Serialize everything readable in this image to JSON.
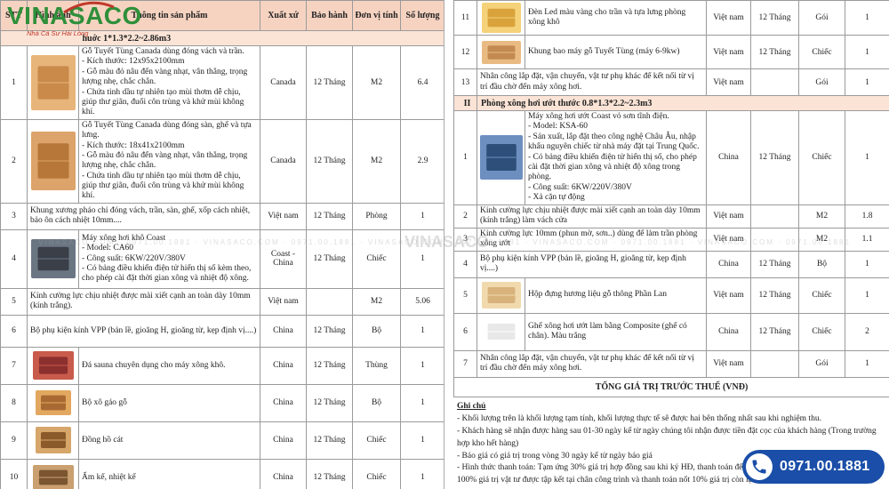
{
  "logo": {
    "name": "VINASACO",
    "tagline": "Nhà Cả Sư Hài Lòng"
  },
  "watermark": {
    "text": "VINASACO.COM · 0971.00.1881 · VINASACO.COM · 0971.00.1881 · VINASACO.COM · 0971.00.1881 · VINASACO.COM · 0971.00.1881 · VINASACO.COM · 0971.00.1881",
    "big": "VINASACO"
  },
  "headers": {
    "stt": "STT",
    "image": "Hình ảnh",
    "info": "Thông tin sản phẩm",
    "origin": "Xuất xứ",
    "warranty": "Bảo hành",
    "unit": "Đơn vị tính",
    "qty": "Số lượng"
  },
  "left": {
    "section": "huớc 1*1.3*2.2~2.86m3",
    "rows": [
      {
        "stt": "1",
        "info": "Gỗ Tuyết Tùng Canada dùng đóng vách và trần.\n- Kích thước: 12x95x2100mm\n- Gỗ màu đỏ nâu đến vàng nhạt, vân thẳng, trọng lượng nhẹ, chắc chắn.\n- Chứa tinh dầu tự nhiên tạo mùi thơm dễ chịu, giúp thư giãn, đuổi côn trùng và khử mùi không khí.",
        "origin": "Canada",
        "warranty": "12 Tháng",
        "unit": "M2",
        "qty": "6.4"
      },
      {
        "stt": "2",
        "info": "Gỗ Tuyết Tùng Canada dùng đóng sàn, ghế và tựa lưng.\n- Kích thước: 18x41x2100mm\n- Gỗ màu đỏ nâu đến vàng nhạt, vân thẳng, trọng lượng nhẹ, chắc chắn.\n- Chứa tinh dầu tự nhiên tạo mùi thơm dễ chịu, giúp thư giãn, đuổi côn trùng và khử mùi không khí.",
        "origin": "Canada",
        "warranty": "12 Tháng",
        "unit": "M2",
        "qty": "2.9"
      },
      {
        "stt": "3",
        "info": "Khung xương pháo chỉ đóng vách, trần, sàn, ghế, xốp cách nhiệt, bảo ôn cách nhiệt 10mm....",
        "origin": "Việt nam",
        "warranty": "12 Tháng",
        "unit": "Phòng",
        "qty": "1"
      },
      {
        "stt": "4",
        "info": "Máy xông hơi khô Coast\n- Model: CA60\n- Công suất: 6KW/220V/380V\n- Có bảng điều khiển điện tử hiển thị số kèm theo, cho phép cài đặt thời gian xông và nhiệt độ xông.",
        "origin": "Coast - China",
        "warranty": "12 Tháng",
        "unit": "Chiếc",
        "qty": "1"
      },
      {
        "stt": "5",
        "info": "Kính cường lực chịu nhiệt được mài xiết cạnh an toàn dày 10mm (kính trắng).",
        "origin": "Việt nam",
        "warranty": "",
        "unit": "M2",
        "qty": "5.06"
      },
      {
        "stt": "6",
        "info": "Bộ phụ kiện kính VPP (bản lề, gioăng H, gioăng từ, kẹp định vị....)",
        "origin": "China",
        "warranty": "12 Tháng",
        "unit": "Bộ",
        "qty": "1"
      },
      {
        "stt": "7",
        "info": "Đá sauna chuyên dụng cho máy xông khô.",
        "origin": "China",
        "warranty": "12 Tháng",
        "unit": "Thùng",
        "qty": "1"
      },
      {
        "stt": "8",
        "info": "Bộ xô gáo gỗ",
        "origin": "China",
        "warranty": "12 Tháng",
        "unit": "Bộ",
        "qty": "1"
      },
      {
        "stt": "9",
        "info": "Đồng hồ cát",
        "origin": "China",
        "warranty": "12 Tháng",
        "unit": "Chiếc",
        "qty": "1"
      },
      {
        "stt": "10",
        "info": "Ẩm kế, nhiệt kế",
        "origin": "China",
        "warranty": "12 Tháng",
        "unit": "Chiếc",
        "qty": "1"
      }
    ]
  },
  "right": {
    "rows_top": [
      {
        "stt": "11",
        "info": "Đèn Led màu vàng cho trần và tựa lưng phòng xông khô",
        "origin": "Việt nam",
        "warranty": "12 Tháng",
        "unit": "Gói",
        "qty": "1"
      },
      {
        "stt": "12",
        "info": "Khung bao máy gỗ Tuyết Tùng (máy 6-9kw)",
        "origin": "Việt nam",
        "warranty": "12 Tháng",
        "unit": "Chiếc",
        "qty": "1"
      },
      {
        "stt": "13",
        "info": "Nhân công lắp đặt, vận chuyển, vật tư phụ khác để kết nối từ vị trí đầu chờ đến máy xông hơi.",
        "origin": "Việt nam",
        "warranty": "",
        "unit": "Gói",
        "qty": "1"
      }
    ],
    "section_num": "II",
    "section": "Phòng xông hơi ướt thước 0.8*1.3*2.2~2.3m3",
    "rows_bottom": [
      {
        "stt": "1",
        "info": "Máy xông hơi ướt Coast vỏ sơn tĩnh điện.\n- Model: KSA-60\n- Sản xuất, lắp đặt theo công nghệ Châu Âu, nhập khẩu nguyên chiếc từ nhà máy đặt tại Trung Quốc.\n- Có bảng điều khiển điện tử hiển thị số, cho phép cài đặt thời gian xông và nhiệt độ xông trong phòng.\n- Công suất: 6KW/220V/380V\n- Xả cặn tự động",
        "origin": "China",
        "warranty": "12 Tháng",
        "unit": "Chiếc",
        "qty": "1"
      },
      {
        "stt": "2",
        "info": "Kính cường lực chịu nhiệt được mài xiết cạnh an toàn dày 10mm (kính trắng) làm vách cửa",
        "origin": "Việt nam",
        "warranty": "",
        "unit": "M2",
        "qty": "1.8"
      },
      {
        "stt": "3",
        "info": "Kính cường lực 10mm (phun mờ, sơn..) dùng để làm trần phòng xông ướt",
        "origin": "Việt nam",
        "warranty": "",
        "unit": "M2",
        "qty": "1.1"
      },
      {
        "stt": "4",
        "info": "Bộ phụ kiện kính VPP (bản lề, gioăng H, gioăng từ, kẹp định vị....)",
        "origin": "China",
        "warranty": "12 Tháng",
        "unit": "Bộ",
        "qty": "1"
      },
      {
        "stt": "5",
        "info": "Hộp đựng hương liệu gỗ thông Phần Lan",
        "origin": "Việt nam",
        "warranty": "12 Tháng",
        "unit": "Chiếc",
        "qty": "1"
      },
      {
        "stt": "6",
        "info": "Ghế xông hơi ướt làm bằng Composite (ghế có chân). Màu trắng",
        "origin": "China",
        "warranty": "12 Tháng",
        "unit": "Chiếc",
        "qty": "2"
      },
      {
        "stt": "7",
        "info": "Nhân công lắp đặt, vận chuyển, vật tư phụ khác để kết nối từ vị trí đầu chờ đến máy xông hơi.",
        "origin": "Việt nam",
        "warranty": "",
        "unit": "Gói",
        "qty": "1"
      }
    ],
    "total": "TỔNG GIÁ TRỊ TRƯỚC THUẾ (VNĐ)",
    "notes_title": "Ghi chú",
    "notes": [
      "- Khối lượng trên là khối lượng tạm tính, khối lượng thực tế sẽ được hai bên thống nhất sau khi nghiệm thu.",
      "- Khách hàng sẽ nhận được hàng sau 01-30 ngày kể từ ngày chúng tôi nhận được tiền đặt cọc của khách hàng (Trong trường hợp kho hết hàng)",
      "- Báo giá có giá trị trong vòng 30 ngày kể từ ngày báo giá",
      "- Hình thức thanh toán: Tạm ứng 30% giá trị hợp đồng sau khi ký HĐ, thanh toán đến 90",
      "100% giá trị vật tư được tập kết tại chân công trình và thanh toán nốt 10% giá trị còn lại của HĐ và nhận phát sinh (nếu có)"
    ]
  },
  "hotline": {
    "number": "0971.00.1881"
  },
  "colors": {
    "header_bg": "#f6d3c1",
    "section_bg": "#fbe4d6",
    "brand_green": "#2f8f3a",
    "brand_red": "#c0392b",
    "hotline_blue": "#1a4ea8"
  }
}
